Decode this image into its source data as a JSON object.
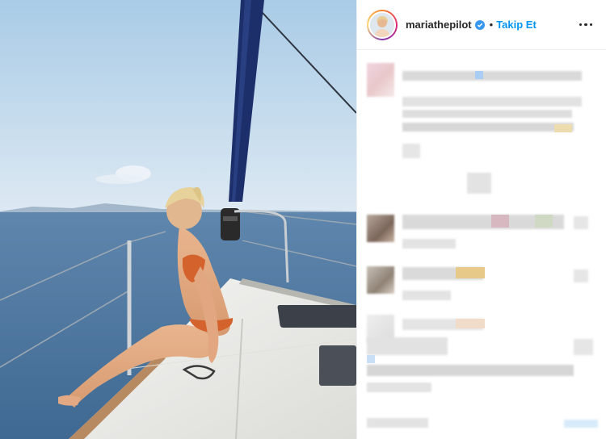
{
  "post": {
    "image_alt": "",
    "author": {
      "username": "mariathepilot",
      "verified": true,
      "follow_label": "Takip Et",
      "separator": "•"
    },
    "more_options_icon": "more-horizontal-icon"
  },
  "colors": {
    "accent": "#0095f6",
    "text": "#262626",
    "divider": "#efefef",
    "verified_badge": "#3897f0"
  }
}
